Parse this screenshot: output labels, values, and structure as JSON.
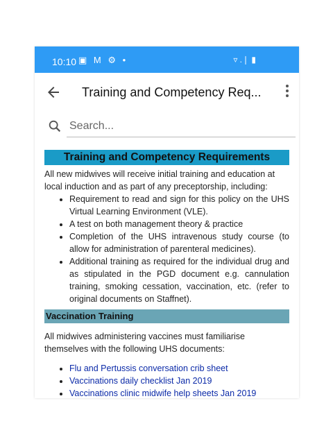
{
  "statusbar": {
    "time": "10:10",
    "left_icons": "▣ M ⚙ •",
    "right_icons": "▿ .❘ ▮"
  },
  "appbar": {
    "title": "Training and Competency Req..."
  },
  "search": {
    "placeholder": "Search..."
  },
  "content": {
    "heading": "Training and Competency Requirements",
    "intro": "All new midwives will receive initial training and education at local induction and as part of any preceptorship, including:",
    "bullets": [
      "Requirement to read and sign for this policy on the UHS Virtual Learning Environment (VLE).",
      "A test on both management theory & practice",
      "Completion of the UHS intravenous study course (to allow for administration of parenteral medicines).",
      "Additional training as required for the individual drug and as stipulated in the PGD document e.g. cannulation training, smoking cessation, vaccination, etc. (refer to original documents on Staffnet)."
    ],
    "vaccination_heading": "Vaccination Training",
    "vaccination_intro": "All midwives administering vaccines must familiarise themselves with the following UHS documents:",
    "links": [
      "Flu and Pertussis conversation crib sheet",
      "Vaccinations daily checklist Jan 2019",
      "Vaccinations clinic midwife help sheets Jan 2019"
    ]
  },
  "colors": {
    "statusbar": "#2e9bf5",
    "heading_bg": "#1a9bc7",
    "subheading_bg": "#6aa5b5",
    "link": "#0b2aa8"
  }
}
